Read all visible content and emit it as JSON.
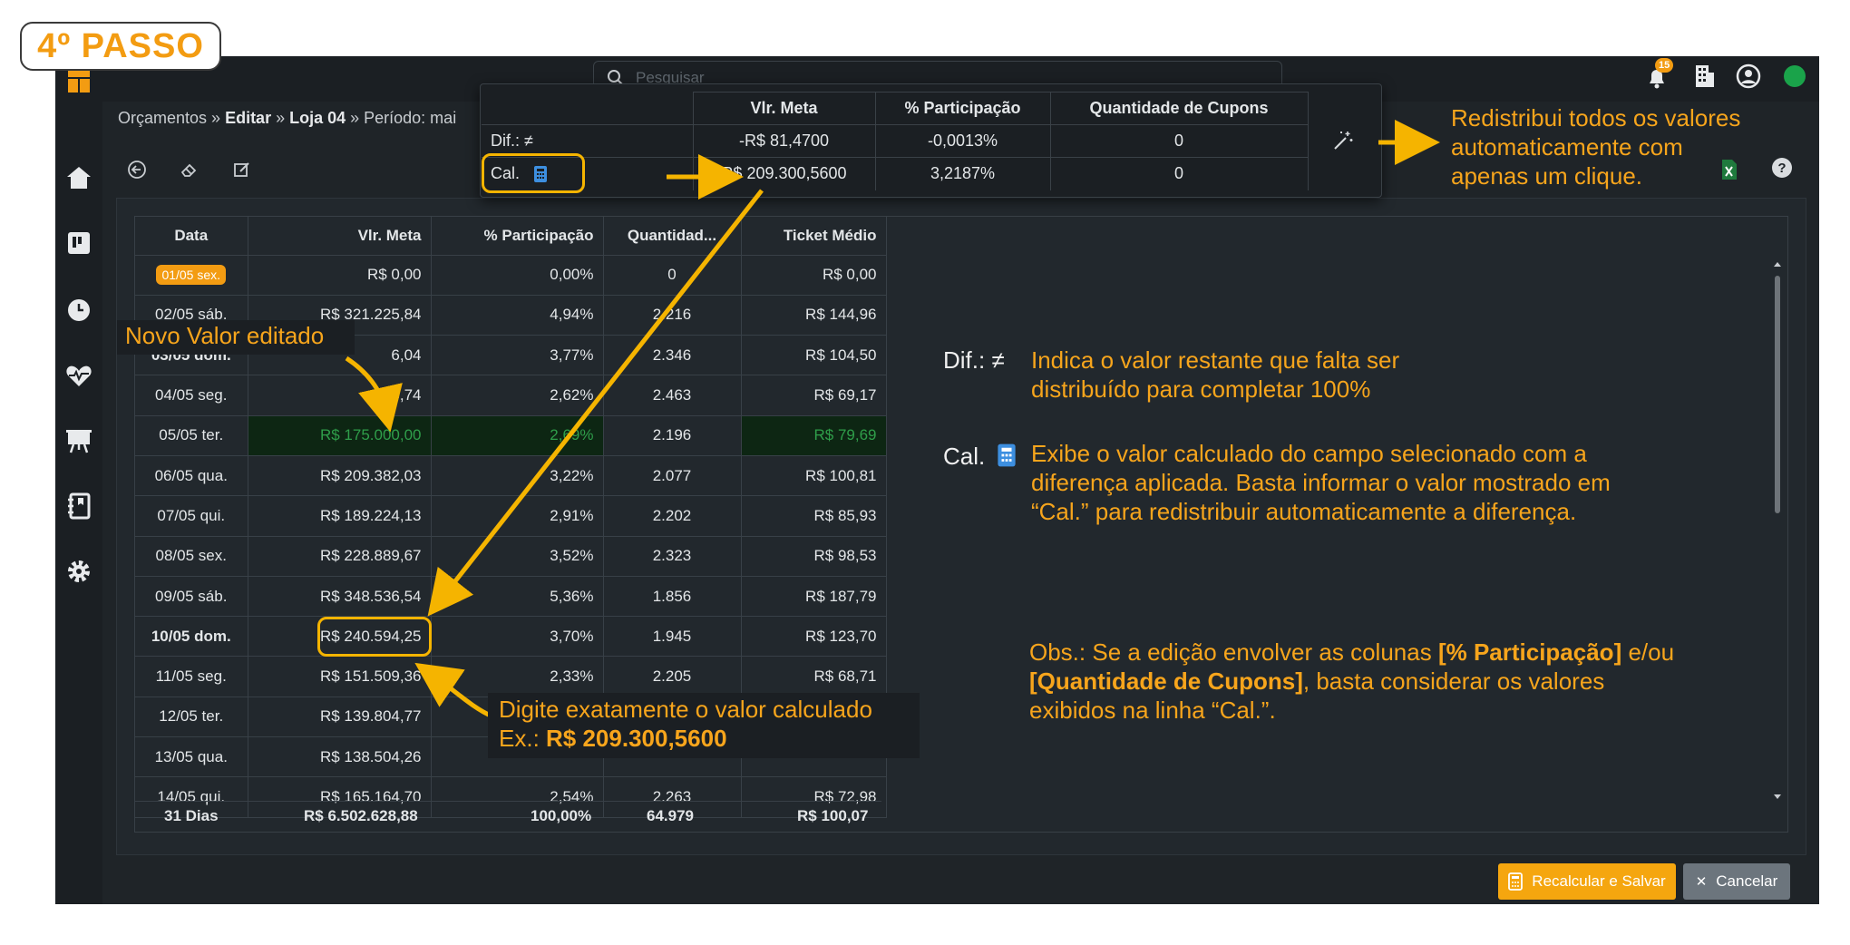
{
  "step_badge": "4º PASSO",
  "topbar": {
    "search_placeholder": "Pesquisar",
    "notifications_count": "15"
  },
  "breadcrumb": {
    "part1": "Orçamentos",
    "sep": " » ",
    "part2": "Editar",
    "part3": "Loja 04",
    "part4": "Período: mai"
  },
  "popup": {
    "headers": [
      "Vlr. Meta",
      "% Participação",
      "Quantidade de Cupons"
    ],
    "dif_label": "Dif.: ≠",
    "dif_values": [
      "-R$ 81,4700",
      "-0,0013%",
      "0"
    ],
    "cal_label": "Cal.",
    "cal_values": [
      "R$ 209.300,5600",
      "3,2187%",
      "0"
    ]
  },
  "table": {
    "headers": [
      "Data",
      "Vlr. Meta",
      "% Participação",
      "Quantidad...",
      "Ticket Médio"
    ],
    "rows": [
      [
        "01/05 sex.",
        "R$ 0,00",
        "0,00%",
        "0",
        "R$ 0,00"
      ],
      [
        "02/05 sáb.",
        "R$ 321.225,84",
        "4,94%",
        "2.216",
        "R$ 144,96"
      ],
      [
        "03/05 dom.",
        "6,04",
        "3,77%",
        "2.346",
        "R$ 104,50"
      ],
      [
        "04/05 seg.",
        "6,74",
        "2,62%",
        "2.463",
        "R$ 69,17"
      ],
      [
        "05/05 ter.",
        "R$ 175.000,00",
        "2,69%",
        "2.196",
        "R$ 79,69"
      ],
      [
        "06/05 qua.",
        "R$ 209.382,03",
        "3,22%",
        "2.077",
        "R$ 100,81"
      ],
      [
        "07/05 qui.",
        "R$ 189.224,13",
        "2,91%",
        "2.202",
        "R$ 85,93"
      ],
      [
        "08/05 sex.",
        "R$ 228.889,67",
        "3,52%",
        "2.323",
        "R$ 98,53"
      ],
      [
        "09/05 sáb.",
        "R$ 348.536,54",
        "5,36%",
        "1.856",
        "R$ 187,79"
      ],
      [
        "10/05 dom.",
        "R$ 240.594,25",
        "3,70%",
        "1.945",
        "R$ 123,70"
      ],
      [
        "11/05 seg.",
        "R$ 151.509,36",
        "2,33%",
        "2.205",
        "R$ 68,71"
      ],
      [
        "12/05 ter.",
        "R$ 139.804,77",
        "",
        "",
        ""
      ],
      [
        "13/05 qua.",
        "R$ 138.504,26",
        "",
        "",
        ""
      ],
      [
        "14/05 qui.",
        "R$ 165.164,70",
        "2,54%",
        "2.263",
        "R$ 72,98"
      ]
    ],
    "totals": [
      "31 Dias",
      "R$ 6.502.628,88",
      "100,00%",
      "64.979",
      "R$ 100,07"
    ]
  },
  "buttons": {
    "save": "Recalcular e Salvar",
    "cancel": "Cancelar"
  },
  "annotations": {
    "redistribute": [
      "Redistribui todos os valores",
      "automaticamente com",
      "apenas um clique."
    ],
    "novo_valor": "Novo Valor editado",
    "digite_line1": "Digite exatamente o valor calculado",
    "digite_ex_prefix": "Ex.: ",
    "digite_ex_value": "R$ 209.300,5600",
    "dif_label": "Dif.: ≠",
    "dif_text": [
      "Indica o valor restante que falta ser",
      "distribuído para completar 100%"
    ],
    "cal_label": "Cal.",
    "cal_text": [
      "Exibe o valor calculado do campo selecionado com a",
      "diferença aplicada. Basta informar o valor mostrado em",
      "“Cal.” para redistribuir automaticamente a diferença."
    ],
    "obs_prefix": "Obs.: Se a edição envolver as colunas ",
    "obs_bold1": "[% Participação]",
    "obs_mid": " e/ou",
    "obs_bold2": "[Quantidade de Cupons]",
    "obs_rest": ", basta considerar os valores",
    "obs_line3": "exibidos na linha “Cal.”."
  },
  "colors": {
    "accent": "#f7a51c",
    "highlight_green": "#2f9e4a",
    "app_bg": "#1f2428"
  }
}
